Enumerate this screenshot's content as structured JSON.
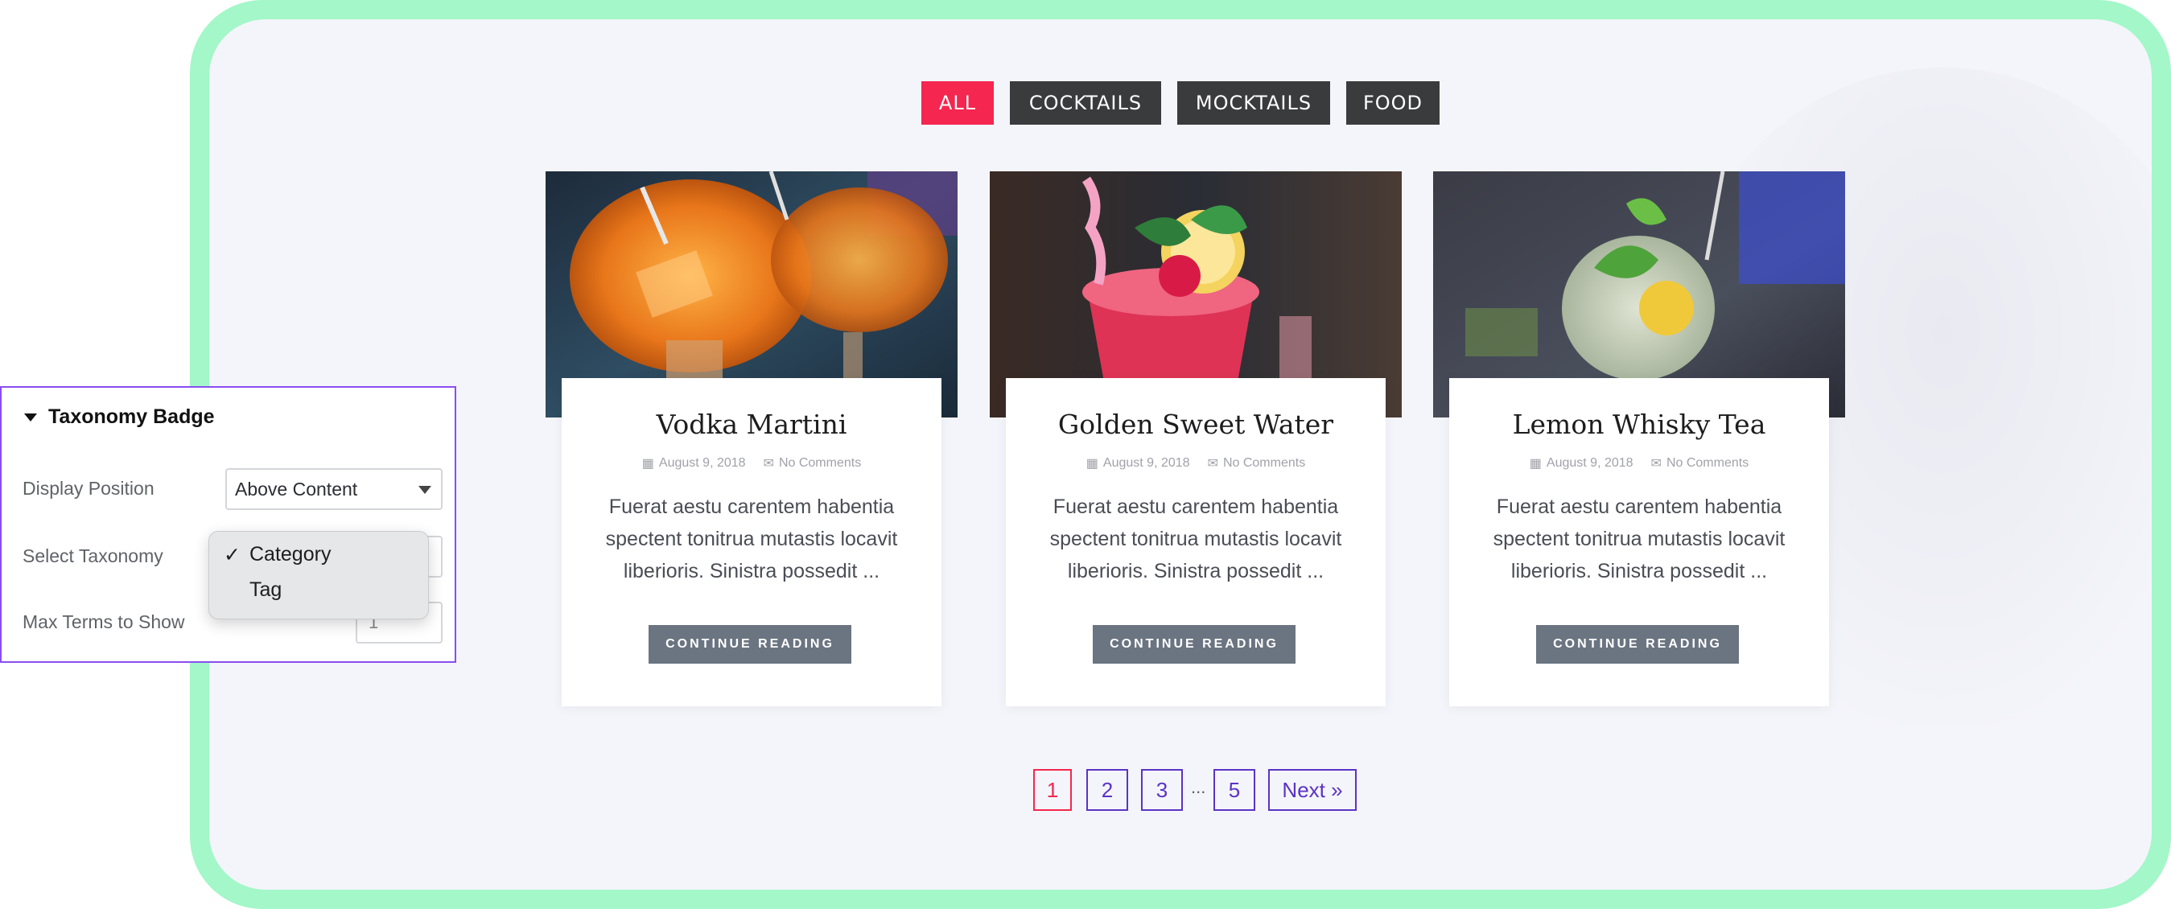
{
  "filters": [
    "ALL",
    "COCKTAILS",
    "MOCKTAILS",
    "FOOD"
  ],
  "posts": [
    {
      "title": "Vodka Martini",
      "date": "August 9, 2018",
      "comments": "No Comments",
      "excerpt": "Fuerat aestu carentem habentia spectent tonitrua mutastis locavit liberioris. Sinistra possedit ...",
      "button": "CONTINUE READING"
    },
    {
      "title": "Golden Sweet Water",
      "date": "August 9, 2018",
      "comments": "No Comments",
      "excerpt": "Fuerat aestu carentem habentia spectent tonitrua mutastis locavit liberioris. Sinistra possedit ...",
      "button": "CONTINUE READING"
    },
    {
      "title": "Lemon Whisky Tea",
      "date": "August 9, 2018",
      "comments": "No Comments",
      "excerpt": "Fuerat aestu carentem habentia spectent tonitrua mutastis locavit liberioris. Sinistra possedit ...",
      "button": "CONTINUE READING"
    }
  ],
  "pagination": {
    "pages": [
      "1",
      "2",
      "3",
      "5"
    ],
    "ellipsis": "...",
    "next": "Next »",
    "current": "1"
  },
  "panel": {
    "title": "Taxonomy Badge",
    "display_position_label": "Display Position",
    "display_position_value": "Above Content",
    "select_taxonomy_label": "Select Taxonomy",
    "taxonomy_options": [
      "Category",
      "Tag"
    ],
    "taxonomy_selected": "Category",
    "max_terms_label": "Max Terms to Show",
    "max_terms_value": "1"
  },
  "colors": {
    "frame": "#a3f7c8",
    "accent": "#f5264f",
    "filter_dark": "#3a3b3d",
    "pagination": "#5b33c6",
    "panel_border": "#8a4df0",
    "button": "#6b7481"
  }
}
